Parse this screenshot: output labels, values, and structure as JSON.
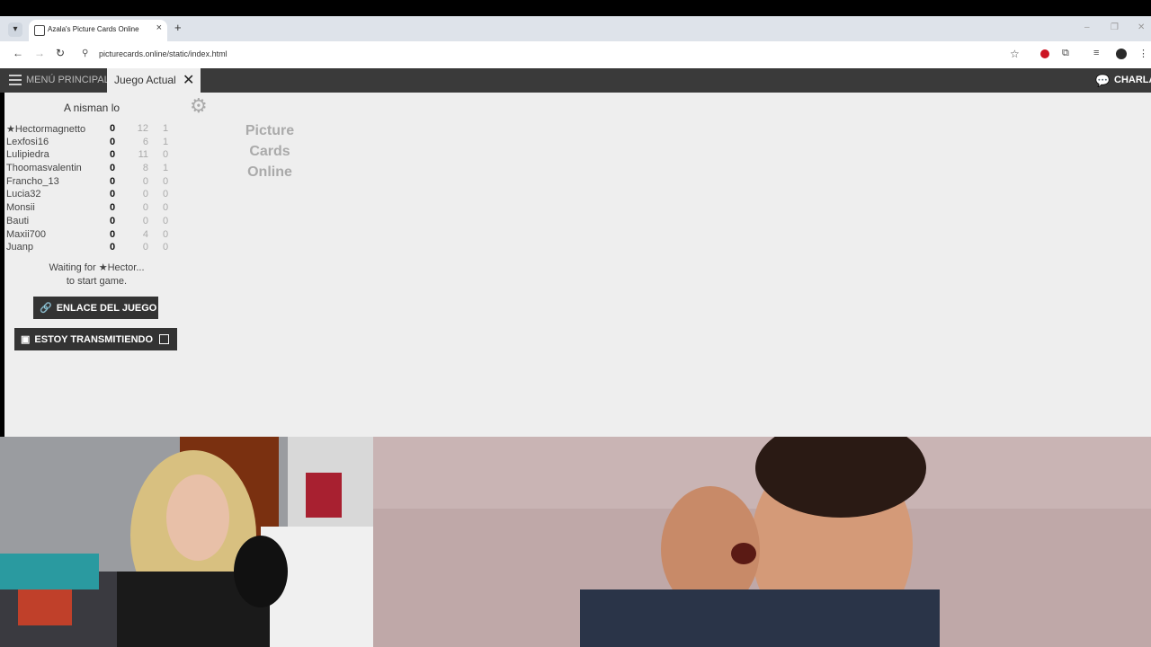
{
  "browser": {
    "tab_title": "Azala's Picture Cards Online",
    "new_tab_symbol": "+",
    "url": "picturecards.online/static/index.html"
  },
  "app": {
    "menu_label": "MENÚ PRINCIPAL",
    "current_tab": "Juego Actual",
    "chat_label": "CHARLA",
    "game_name": "A nisman lo",
    "logo_lines": [
      "Picture",
      "Cards",
      "Online"
    ],
    "players": [
      {
        "name": "Hectormagnetto",
        "score": "0",
        "col2": "12",
        "col3": "1",
        "host": true
      },
      {
        "name": "Lexfosi16",
        "score": "0",
        "col2": "6",
        "col3": "1"
      },
      {
        "name": "Lulipiedra",
        "score": "0",
        "col2": "11",
        "col3": "0"
      },
      {
        "name": "Thoomasvalentin",
        "score": "0",
        "col2": "8",
        "col3": "1"
      },
      {
        "name": "Francho_13",
        "score": "0",
        "col2": "0",
        "col3": "0"
      },
      {
        "name": "Lucia32",
        "score": "0",
        "col2": "0",
        "col3": "0"
      },
      {
        "name": "Monsii",
        "score": "0",
        "col2": "0",
        "col3": "0"
      },
      {
        "name": "Bauti",
        "score": "0",
        "col2": "0",
        "col3": "0"
      },
      {
        "name": "Maxii700",
        "score": "0",
        "col2": "4",
        "col3": "0"
      },
      {
        "name": "Juanp",
        "score": "0",
        "col2": "0",
        "col3": "0"
      }
    ],
    "waiting_prefix": "Waiting for",
    "waiting_host": "Hector...",
    "waiting_suffix": "to start game.",
    "link_button": "ENLACE DEL JUEGO",
    "stream_button": "ESTOY TRANSMITIENDO"
  },
  "colors": {
    "opera": "#cc1422",
    "appbar": "#3a3a3a",
    "page_bg": "#eeeeee"
  }
}
